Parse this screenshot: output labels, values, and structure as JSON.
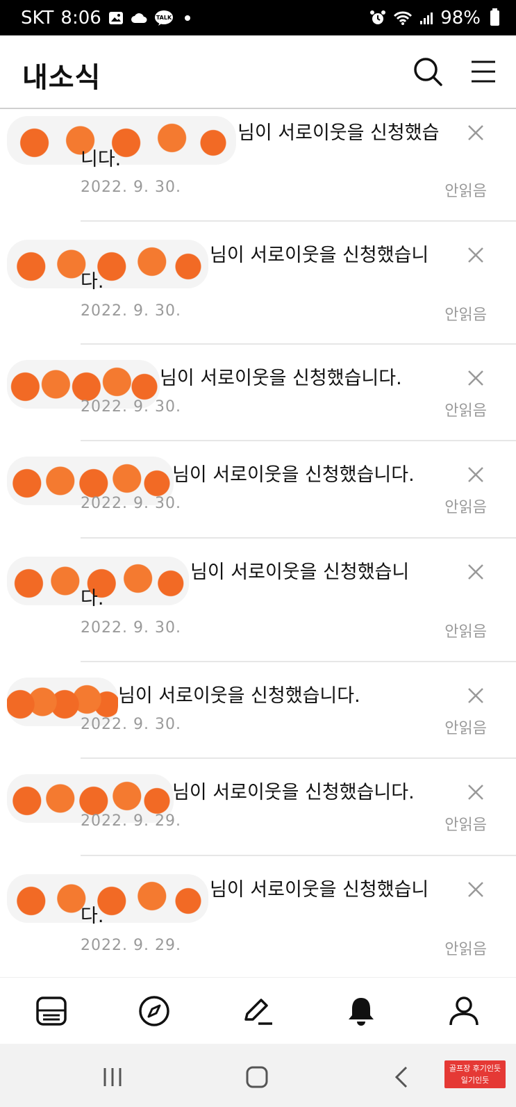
{
  "status_bar": {
    "carrier": "SKT",
    "time": "8:06",
    "kakao_badge": "TALK",
    "battery": "98%"
  },
  "header": {
    "title": "내소식",
    "icons": [
      "search-icon",
      "menu-icon"
    ]
  },
  "notifications": [
    {
      "message": "님이 서로이웃을 신청했습니다.",
      "date": "2022. 9. 30.",
      "status": "안읽음"
    },
    {
      "message": "님이 서로이웃을 신청했습니다.",
      "date": "2022. 9. 30.",
      "status": "안읽음"
    },
    {
      "message": "님이 서로이웃을 신청했습니다.",
      "date": "2022. 9. 30.",
      "status": "안읽음"
    },
    {
      "message": "님이 서로이웃을 신청했습니다.",
      "date": "2022. 9. 30.",
      "status": "안읽음"
    },
    {
      "message": "님이 서로이웃을 신청했습니다.",
      "date": "2022. 9. 30.",
      "status": "안읽음"
    },
    {
      "message": "님이 서로이웃을 신청했습니다.",
      "date": "2022. 9. 30.",
      "status": "안읽음"
    },
    {
      "message": "님이 서로이웃을 신청했습니다.",
      "date": "2022. 9. 29.",
      "status": "안읽음"
    },
    {
      "message": "님이 서로이웃을 신청했습니다.",
      "date": "2022. 9. 29.",
      "status": "안읽음"
    }
  ],
  "bottom_nav": {
    "items": [
      "feed-icon",
      "compass-icon",
      "pencil-icon",
      "bell-icon",
      "profile-icon"
    ],
    "active": "bell-icon"
  },
  "system_nav": {
    "watermark_line1": "골프장 후기인듯",
    "watermark_line2": "일기인듯"
  },
  "colors": {
    "status_bar_bg": "#000000",
    "text": "#111111",
    "muted": "#9a9a9a",
    "divider": "#e6e6e6",
    "redaction": "#f26a25"
  }
}
